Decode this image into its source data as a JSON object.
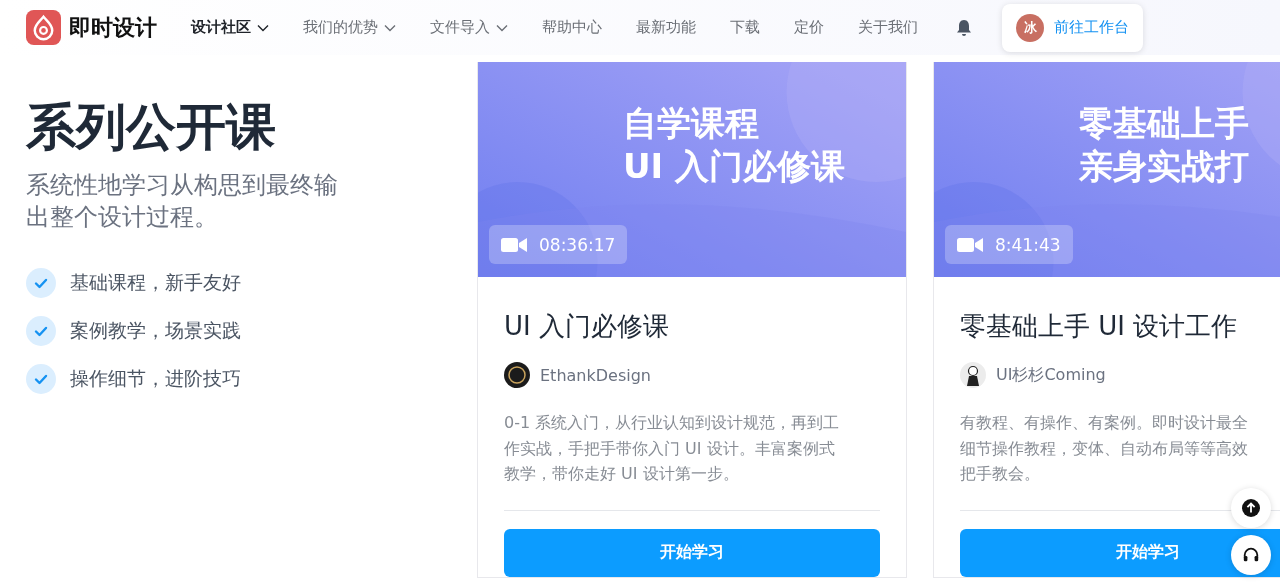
{
  "header": {
    "brand": "即时设计",
    "nav": [
      {
        "label": "设计社区",
        "selected": true,
        "dropdown": true
      },
      {
        "label": "我们的优势",
        "selected": false,
        "dropdown": true
      },
      {
        "label": "文件导入",
        "selected": false,
        "dropdown": true
      },
      {
        "label": "帮助中心",
        "selected": false,
        "dropdown": false
      },
      {
        "label": "最新功能",
        "selected": false,
        "dropdown": false
      },
      {
        "label": "下载",
        "selected": false,
        "dropdown": false
      },
      {
        "label": "定价",
        "selected": false,
        "dropdown": false
      },
      {
        "label": "关于我们",
        "selected": false,
        "dropdown": false
      }
    ],
    "avatar": "冰",
    "workspace_button": "前往工作台"
  },
  "intro": {
    "title": "系列公开课",
    "subtitle": "系统性地学习从构思到最终输出整个设计过程。",
    "features": [
      "基础课程，新手友好",
      "案例教学，场景实践",
      "操作细节，进阶技巧"
    ]
  },
  "courses": [
    {
      "cover_lines": [
        "自学课程",
        "UI 入门必修课"
      ],
      "duration": "08:36:17",
      "title": "UI 入门必修课",
      "author": {
        "name": "EthankDesign",
        "kind": "dark"
      },
      "description_lines": [
        "0-1 系统入门，从行业认知到设计规范，再到工",
        "作实战，手把手带你入门 UI 设计。丰富案例式",
        "教学，带你走好 UI 设计第一步。"
      ],
      "button": "开始学习"
    },
    {
      "cover_lines": [
        "零基础上手",
        "亲身实战打"
      ],
      "duration": "8:41:43",
      "title": "零基础上手 UI 设计工作",
      "author": {
        "name": "UI杉杉Coming",
        "kind": "light"
      },
      "description_lines": [
        "有教程、有操作、有案例。即时设计最全",
        "细节操作教程，变体、自动布局等等高效",
        "把手教会。"
      ],
      "button": "开始学习"
    }
  ]
}
